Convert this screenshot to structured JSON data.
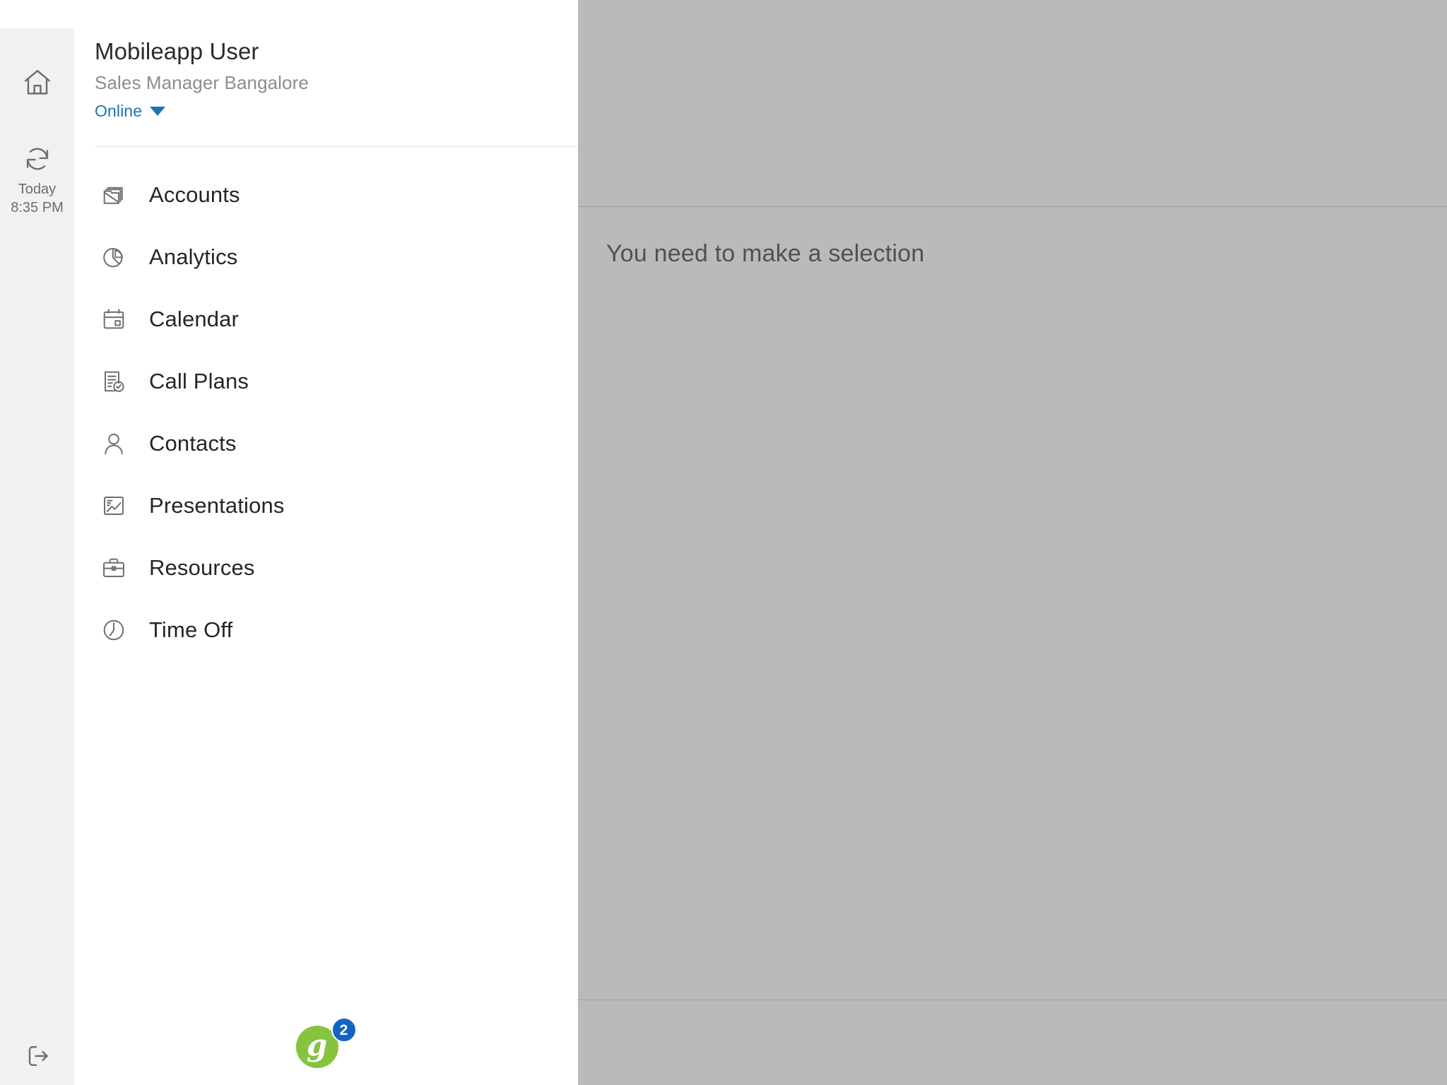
{
  "rail": {
    "home": {
      "icon": "home-icon",
      "label": ""
    },
    "sync": {
      "icon": "sync-refresh-icon",
      "line1": "Today",
      "line2": "8:35 PM"
    },
    "logout": {
      "icon": "logout-icon",
      "label": ""
    }
  },
  "drawer": {
    "user_name": "Mobileapp User",
    "user_role": "Sales Manager Bangalore",
    "status_label": "Online",
    "status_caret_icon": "chevron-down-icon",
    "menu": [
      {
        "label": "Accounts",
        "icon": "accounts-folder-icon"
      },
      {
        "label": "Analytics",
        "icon": "pie-chart-icon"
      },
      {
        "label": "Calendar",
        "icon": "calendar-icon"
      },
      {
        "label": "Call Plans",
        "icon": "document-check-icon"
      },
      {
        "label": "Contacts",
        "icon": "person-icon"
      },
      {
        "label": "Presentations",
        "icon": "chart-frame-icon"
      },
      {
        "label": "Resources",
        "icon": "briefcase-icon"
      },
      {
        "label": "Time Off",
        "icon": "clock-icon"
      }
    ],
    "footer": {
      "logo_letter": "g",
      "badge_count": "2",
      "logo_color": "#86c440",
      "badge_color": "#1565c0"
    }
  },
  "content": {
    "empty_message": "You need to make a selection"
  },
  "colors": {
    "rail_bg": "#f1f1f1",
    "drawer_bg": "#ffffff",
    "link_blue": "#1a74b4",
    "icon_gray": "#6e6e6e",
    "scrim": "rgba(90,90,90,0.42)"
  }
}
